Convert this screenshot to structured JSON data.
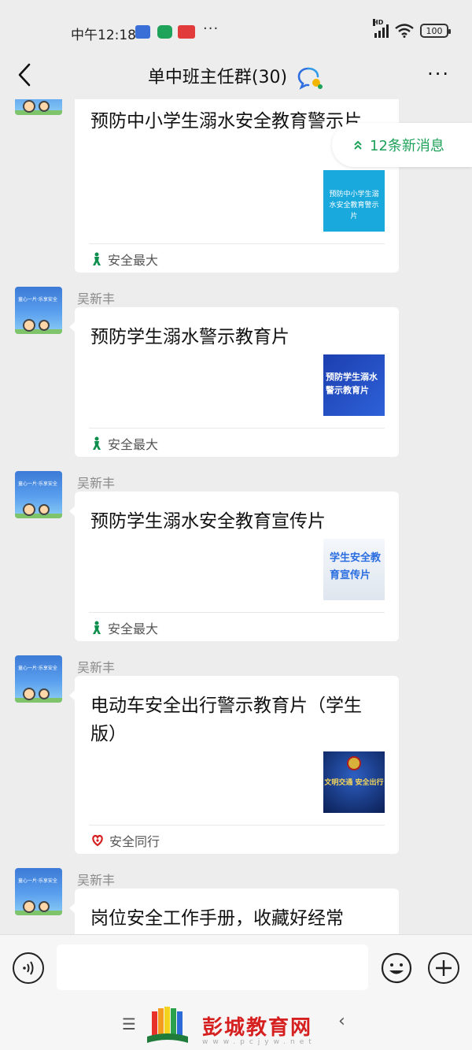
{
  "status_bar": {
    "time": "中午12:18",
    "more": "···",
    "battery": "100",
    "network": "HD"
  },
  "header": {
    "title": "单中班主任群(30)"
  },
  "new_messages": {
    "label": "12条新消息"
  },
  "messages": [
    {
      "sender": "",
      "title": "预防中小学生溺水安全教育警示片",
      "thumb_text": "预防中小学生溺水安全教育警示片",
      "source": "安全最大"
    },
    {
      "sender": "吴新丰",
      "title": "预防学生溺水警示教育片",
      "thumb_text": "预防学生溺水警示教育片",
      "source": "安全最大"
    },
    {
      "sender": "吴新丰",
      "title": "预防学生溺水安全教育宣传片",
      "thumb_text": "学生安全教育宣传片",
      "source": "安全最大"
    },
    {
      "sender": "吴新丰",
      "title": "电动车安全出行警示教育片（学生版）",
      "thumb_text": "文明交通 安全出行",
      "source": "安全同行"
    },
    {
      "sender": "吴新丰",
      "title": "岗位安全工作手册，收藏好经常",
      "thumb_text": "",
      "source": ""
    }
  ],
  "avatar_text": "童心一片·乐享安全",
  "watermark": {
    "text": "彭城教育网",
    "url": "www.pcjyw.net"
  },
  "colors": {
    "accent_green": "#1fa25a",
    "source_green": "#0f8f4e",
    "source_red": "#d62020",
    "background": "#ededed"
  }
}
